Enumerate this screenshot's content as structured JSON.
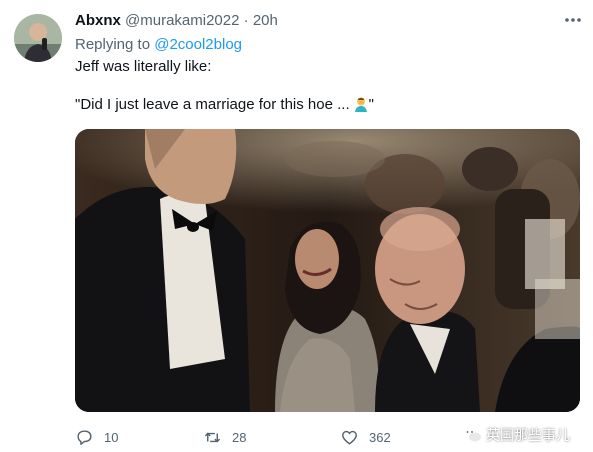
{
  "tweet": {
    "author_name": "Abxnx",
    "handle": "@murakami2022",
    "separator": "·",
    "time": "20h",
    "replying_prefix": "Replying to",
    "replying_to": "@2cool2blog",
    "line1": "Jeff was literally like:",
    "line2": "\"Did I just leave a marriage for this hoe ...",
    "line2_end": "\"",
    "emoji_icon": "man-facepalming-emoji"
  },
  "actions": {
    "reply_count": "10",
    "retweet_count": "28",
    "like_count": "362"
  },
  "watermark": {
    "text": "英国那些事儿"
  },
  "colors": {
    "link": "#1d9bf0",
    "secondary": "#536471",
    "text": "#0f1419"
  }
}
